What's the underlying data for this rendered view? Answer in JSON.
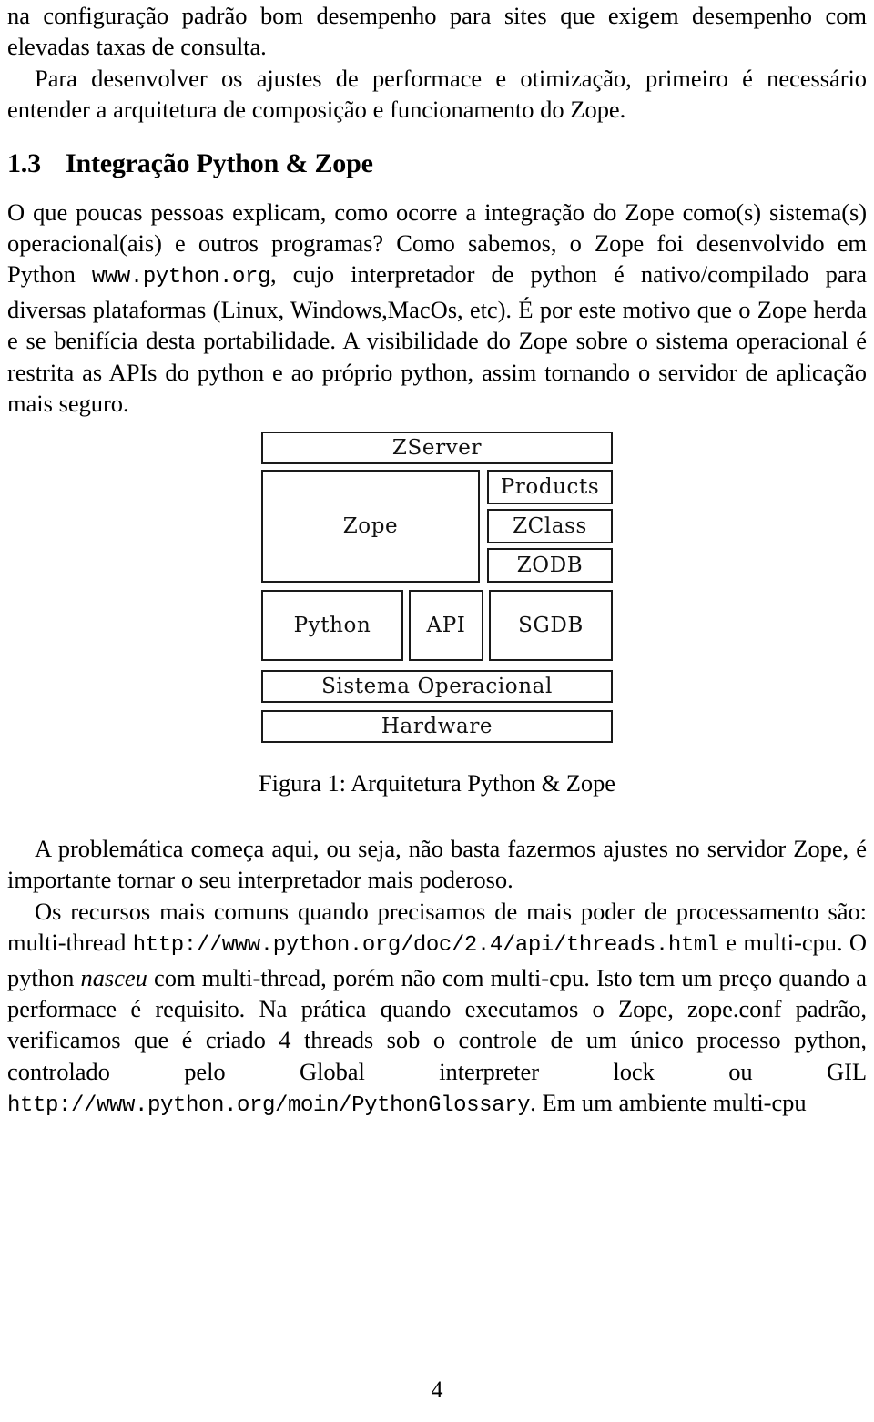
{
  "document": {
    "page_number": "4",
    "section": {
      "number": "1.3",
      "title": "Integração Python & Zope"
    },
    "paragraphs": {
      "p_continued": "na configuração padrão bom desempenho para sites que exigem desempenho com elevadas taxas de consulta.",
      "p_performance": "Para desenvolver os ajustes de performace e otimização, primeiro é necessário entender a arquitetura de composição e funcionamento do Zope.",
      "p_integration_a": "O que poucas pessoas explicam, como ocorre a integração do Zope como(s) sistema(s) operacional(ais) e outros programas? Como sabemos, o Zope foi desenvolvido em Python ",
      "p_integration_url": "www.python.org",
      "p_integration_b": ", cujo interpretador de python é nativo/compilado para diversas plataformas (Linux, Windows,MacOs, etc). É por este motivo que o Zope herda e se benifícia desta portabilidade. A visibilidade do Zope sobre o sistema operacional é restrita as APIs do python e ao próprio python, assim tornando o servidor de aplicação mais seguro.",
      "p_problematica": "A problemática começa aqui, ou seja, não basta fazermos ajustes no servidor Zope, é importante tornar o seu interpretador mais poderoso.",
      "p_recursos_a": "Os recursos mais comuns quando precisamos de mais poder de processamento são: multi-thread ",
      "p_recursos_url1": "http://www.python.org/doc/2.4/api/threads.html",
      "p_recursos_b": " e multi-cpu. O python ",
      "p_recursos_italic": "nasceu",
      "p_recursos_c": " com multi-thread, porém não com multi-cpu. Isto tem um preço quando a performace é requisito. Na prática quando executamos o Zope, zope.conf padrão, verificamos que é criado 4 threads sob o controle de um único processo python, controlado pelo Global interpreter lock ou GIL ",
      "p_recursos_url2": "http://www.python.org/moin/PythonGlossary",
      "p_recursos_d": ". Em um ambiente multi-cpu"
    },
    "figure": {
      "caption": "Figura 1: Arquitetura Python & Zope",
      "boxes": {
        "zserver": "ZServer",
        "zope": "Zope",
        "products": "Products",
        "zclass": "ZClass",
        "zodb": "ZODB",
        "python": "Python",
        "api": "API",
        "sgdb": "SGDB",
        "sistema_operacional": "Sistema Operacional",
        "hardware": "Hardware"
      }
    }
  }
}
